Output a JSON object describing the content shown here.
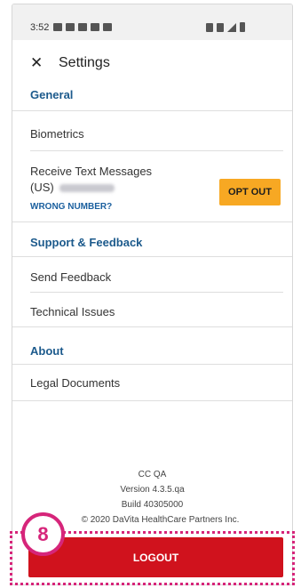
{
  "status_bar": {
    "time": "3:52"
  },
  "header": {
    "close_icon": "close-icon",
    "title": "Settings"
  },
  "sections": {
    "general": {
      "title": "General",
      "biometrics": "Biometrics",
      "sms_label_line1": "Receive Text Messages",
      "sms_label_line2": "(US)",
      "wrong_number": "WRONG NUMBER?",
      "opt_out": "OPT OUT"
    },
    "support": {
      "title": "Support & Feedback",
      "send_feedback": "Send Feedback",
      "technical_issues": "Technical Issues"
    },
    "about": {
      "title": "About",
      "legal_documents": "Legal Documents"
    }
  },
  "footer": {
    "app_name": "CC QA",
    "version": "Version 4.3.5.qa",
    "build": "Build 40305000",
    "copyright": "© 2020 DaVita HealthCare Partners Inc."
  },
  "logout": {
    "label": "LOGOUT"
  },
  "step_badge": {
    "number": "8"
  },
  "colors": {
    "section_heading": "#1c5a8c",
    "opt_out_bg": "#f7a823",
    "logout_bg": "#d0121d",
    "highlight": "#d6257a"
  }
}
